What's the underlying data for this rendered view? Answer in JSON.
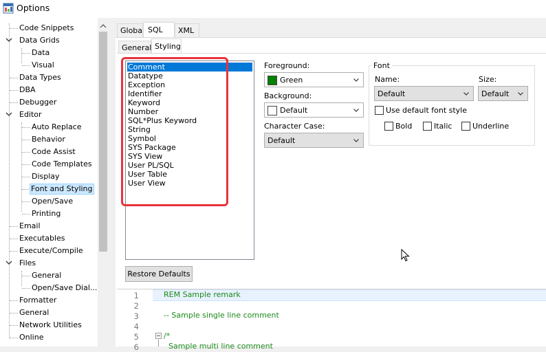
{
  "window": {
    "title": "Options"
  },
  "tree": {
    "items": [
      {
        "label": "Code Snippets"
      },
      {
        "label": "Data Grids"
      },
      {
        "label": "Data"
      },
      {
        "label": "Visual"
      },
      {
        "label": "Data Types"
      },
      {
        "label": "DBA"
      },
      {
        "label": "Debugger"
      },
      {
        "label": "Editor"
      },
      {
        "label": "Auto Replace"
      },
      {
        "label": "Behavior"
      },
      {
        "label": "Code Assist"
      },
      {
        "label": "Code Templates"
      },
      {
        "label": "Display"
      },
      {
        "label": "Font and Styling"
      },
      {
        "label": "Open/Save"
      },
      {
        "label": "Printing"
      },
      {
        "label": "Email"
      },
      {
        "label": "Executables"
      },
      {
        "label": "Execute/Compile"
      },
      {
        "label": "Files"
      },
      {
        "label": "General"
      },
      {
        "label": "Open/Save Dial..."
      },
      {
        "label": "Formatter"
      },
      {
        "label": "General"
      },
      {
        "label": "Network Utilities"
      },
      {
        "label": "Online"
      }
    ]
  },
  "tabs": {
    "global": "Global",
    "sql": "SQL",
    "xml": "XML"
  },
  "subtabs": {
    "general": "General",
    "styling": "Styling"
  },
  "tokens": [
    "Comment",
    "Datatype",
    "Exception",
    "Identifier",
    "Keyword",
    "Number",
    "SQL*Plus Keyword",
    "String",
    "Symbol",
    "SYS Package",
    "SYS View",
    "User PL/SQL",
    "User Table",
    "User View"
  ],
  "foreground": {
    "label": "Foreground:",
    "value": "Green",
    "color": "#008000"
  },
  "background": {
    "label": "Background:",
    "value": "Default",
    "color": "#ffffff"
  },
  "char_case": {
    "label": "Character Case:",
    "value": "Default"
  },
  "font": {
    "group_label": "Font",
    "name_label": "Name:",
    "name_value": "Default",
    "size_label": "Size:",
    "size_value": "Default",
    "use_default_label": "Use default font style",
    "bold_label": "Bold",
    "italic_label": "Italic",
    "underline_label": "Underline"
  },
  "restore_label": "Restore Defaults",
  "editor": {
    "lines": [
      {
        "num": "1",
        "text": "REM Sample remark"
      },
      {
        "num": "2",
        "text": ""
      },
      {
        "num": "3",
        "text": "-- Sample single line comment"
      },
      {
        "num": "4",
        "text": ""
      },
      {
        "num": "5",
        "text": "/*"
      },
      {
        "num": "6",
        "text": "  Sample multi line comment"
      }
    ]
  }
}
